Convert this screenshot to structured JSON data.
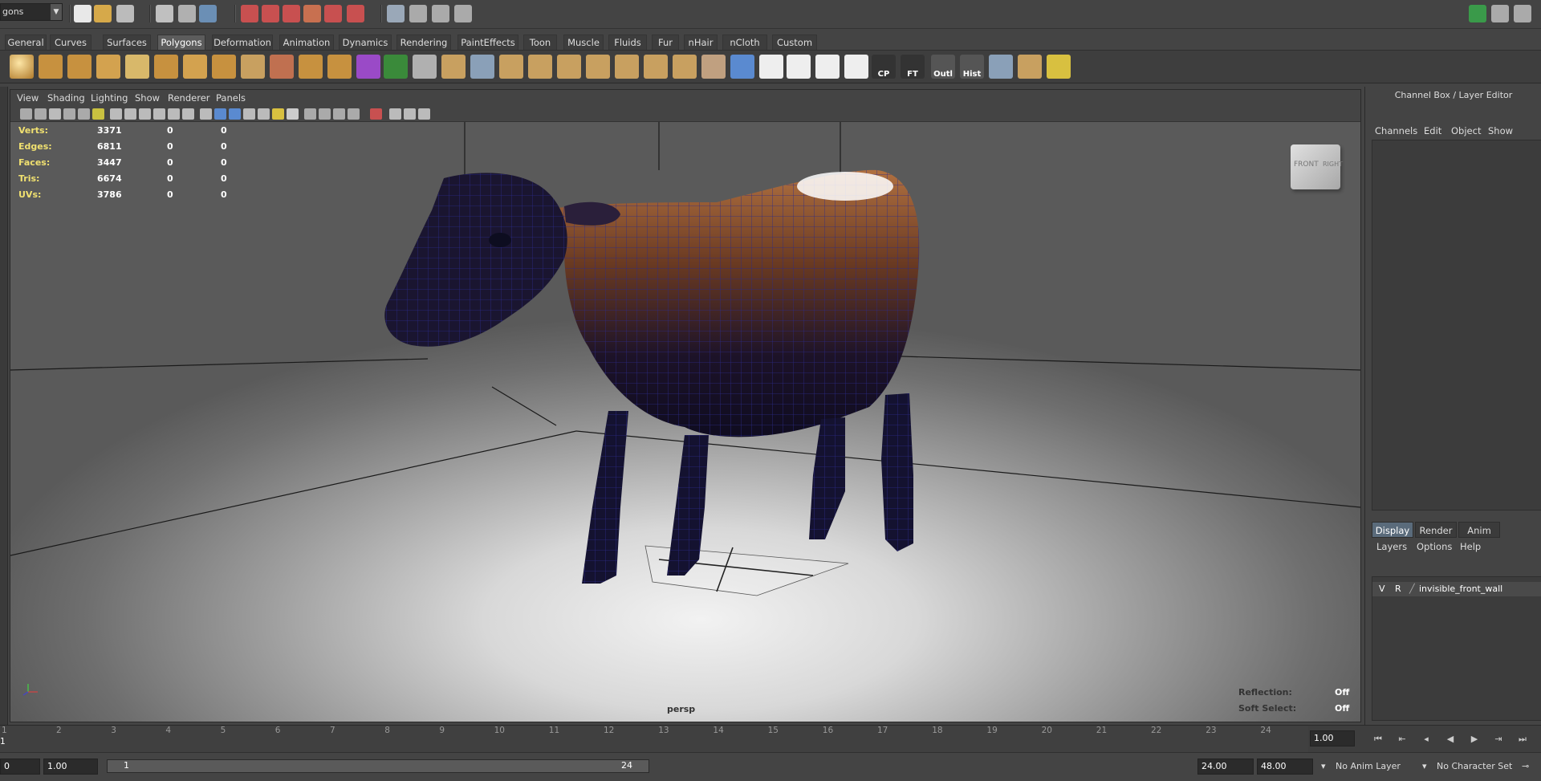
{
  "status_line": {
    "mode": "gons"
  },
  "shelf_tabs": [
    {
      "label": "General",
      "active": false
    },
    {
      "label": "Curves",
      "active": false
    },
    {
      "label": "Surfaces",
      "active": false
    },
    {
      "label": "Polygons",
      "active": true
    },
    {
      "label": "Deformation",
      "active": false
    },
    {
      "label": "Animation",
      "active": false
    },
    {
      "label": "Dynamics",
      "active": false
    },
    {
      "label": "Rendering",
      "active": false
    },
    {
      "label": "PaintEffects",
      "active": false
    },
    {
      "label": "Toon",
      "active": false
    },
    {
      "label": "Muscle",
      "active": false
    },
    {
      "label": "Fluids",
      "active": false
    },
    {
      "label": "Fur",
      "active": false
    },
    {
      "label": "nHair",
      "active": false
    },
    {
      "label": "nCloth",
      "active": false
    },
    {
      "label": "Custom",
      "active": false
    }
  ],
  "shelf_labels": {
    "cp": "CP",
    "ft": "FT",
    "outl": "Outl",
    "hist": "Hist"
  },
  "panel_menu": [
    "View",
    "Shading",
    "Lighting",
    "Show",
    "Renderer",
    "Panels"
  ],
  "hud": {
    "rows": [
      {
        "label": "Verts:",
        "values": [
          "3371",
          "0",
          "0"
        ]
      },
      {
        "label": "Edges:",
        "values": [
          "6811",
          "0",
          "0"
        ]
      },
      {
        "label": "Faces:",
        "values": [
          "3447",
          "0",
          "0"
        ]
      },
      {
        "label": "Tris:",
        "values": [
          "6674",
          "0",
          "0"
        ]
      },
      {
        "label": "UVs:",
        "values": [
          "3786",
          "0",
          "0"
        ]
      }
    ],
    "camera": "persp",
    "reflection_label": "Reflection:",
    "reflection_value": "Off",
    "soft_select_label": "Soft Select:",
    "soft_select_value": "Off",
    "view_cube_front": "FRONT",
    "view_cube_right": "RIGHT"
  },
  "channel_box": {
    "title": "Channel Box / Layer Editor",
    "menu": [
      "Channels",
      "Edit",
      "Object",
      "Show"
    ]
  },
  "layer_editor": {
    "tabs": [
      {
        "label": "Display",
        "active": true
      },
      {
        "label": "Render",
        "active": false
      },
      {
        "label": "Anim",
        "active": false
      }
    ],
    "menu": [
      "Layers",
      "Options",
      "Help"
    ],
    "layer": {
      "v": "V",
      "r": "R",
      "name": "invisible_front_wall"
    }
  },
  "time_slider": {
    "ticks": [
      "2",
      "3",
      "4",
      "5",
      "6",
      "7",
      "8",
      "9",
      "10",
      "11",
      "12",
      "13",
      "14",
      "15",
      "16",
      "17",
      "18",
      "19",
      "20",
      "21",
      "22",
      "23",
      "24"
    ],
    "first": "1",
    "current_frame_label": "1",
    "current_frame": "1.00"
  },
  "range_slider": {
    "start_anim": "0",
    "start_range": "1.00",
    "bar_start": "1",
    "bar_end": "24",
    "end_range": "24.00",
    "end_anim": "48.00",
    "anim_layer": "No Anim Layer",
    "character_set": "No Character Set"
  }
}
